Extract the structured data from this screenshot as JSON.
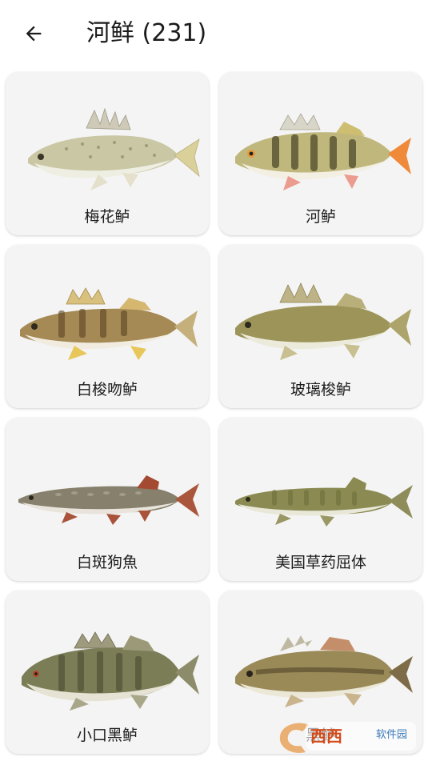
{
  "appbar": {
    "title": "河鲜 (231)",
    "back_icon": "arrow-left-icon"
  },
  "fish": [
    {
      "name": "梅花鲈"
    },
    {
      "name": "河鲈"
    },
    {
      "name": "白梭吻鲈"
    },
    {
      "name": "玻璃梭鲈"
    },
    {
      "name": "白斑狗魚"
    },
    {
      "name": "美国草药屈体"
    },
    {
      "name": "小口黑鲈"
    },
    {
      "name": "黑鲈"
    }
  ],
  "watermark": {
    "brand": "西西",
    "text": "软件园",
    "logo_icon": "watermark-logo-icon"
  }
}
